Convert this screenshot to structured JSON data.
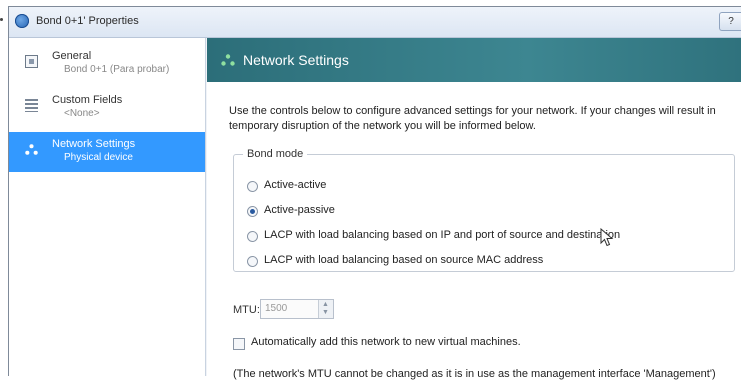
{
  "window": {
    "title": "Bond 0+1' Properties",
    "help_button": "?"
  },
  "sidebar": {
    "items": [
      {
        "label": "General",
        "sublabel": "Bond 0+1 (Para probar)",
        "icon": "general-icon",
        "active": false
      },
      {
        "label": "Custom Fields",
        "sublabel": "<None>",
        "icon": "custom-fields-icon",
        "active": false
      },
      {
        "label": "Network Settings",
        "sublabel": "Physical device",
        "icon": "network-icon",
        "active": true
      }
    ]
  },
  "main": {
    "header": "Network Settings",
    "description": "Use the controls below to configure advanced settings for your network. If your changes will result in temporary disruption of the network you will be informed below.",
    "bond_mode": {
      "label": "Bond mode",
      "options": [
        {
          "label": "Active-active",
          "selected": false
        },
        {
          "label": "Active-passive",
          "selected": true
        },
        {
          "label": "LACP with load balancing based on IP and port of source and destination",
          "selected": false
        },
        {
          "label": "LACP with load balancing based on source MAC address",
          "selected": false
        }
      ]
    },
    "mtu": {
      "label": "MTU:",
      "value": "1500"
    },
    "auto_add": {
      "label": "Automatically add this network to new virtual machines.",
      "checked": false
    },
    "note": "(The network's MTU cannot be changed as it is in use as the management interface 'Management')"
  },
  "colors": {
    "header_bg": "#3d8691",
    "selection": "#3399ff"
  }
}
